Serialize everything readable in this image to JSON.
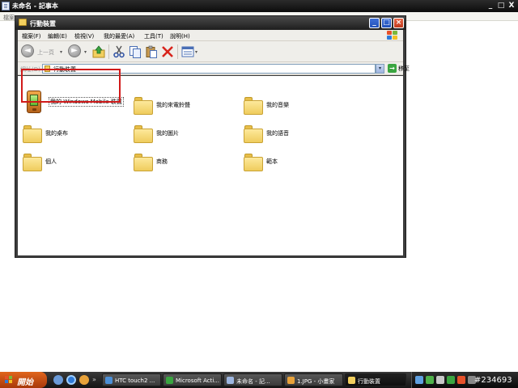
{
  "notepad": {
    "title": "未命名 - 記事本",
    "menu_file": "檔案",
    "minimize": "_",
    "maximize": "□",
    "close": "X"
  },
  "explorer": {
    "title": "行動裝置",
    "menu": [
      "檔案(F)",
      "編輯(E)",
      "檢視(V)",
      "我的最愛(A)",
      "工具(T)",
      "說明(H)"
    ],
    "toolbar": {
      "back_label": "上一頁",
      "back_glyph": "◄",
      "forward_glyph": "►",
      "dropdown_glyph": "▾"
    },
    "address": {
      "label": "網址(D)",
      "value": "行動裝置",
      "dropdown_glyph": "▾",
      "go_glyph": "→",
      "go_label": "移至"
    },
    "items": [
      {
        "label": "我的 Windows Mobile 裝置",
        "icon": "pda-device-icon"
      },
      {
        "label": "我的來電鈴聲",
        "icon": "folder-icon"
      },
      {
        "label": "我的音樂",
        "icon": "folder-icon"
      },
      {
        "label": "我的桌布",
        "icon": "folder-icon"
      },
      {
        "label": "我的圖片",
        "icon": "folder-icon"
      },
      {
        "label": "我的語音",
        "icon": "folder-icon"
      },
      {
        "label": "個人",
        "icon": "folder-icon"
      },
      {
        "label": "商務",
        "icon": "folder-icon"
      },
      {
        "label": "範本",
        "icon": "folder-icon"
      }
    ]
  },
  "taskbar": {
    "start": "開始",
    "tasks": [
      {
        "label": "HTC touch2 ...",
        "icon_color": "#4c8fd6"
      },
      {
        "label": "Microsoft Acti...",
        "icon_color": "#3aa540"
      },
      {
        "label": "未命名 - 記...",
        "icon_color": "#9db6e0"
      },
      {
        "label": "1.JPG - 小畫家",
        "icon_color": "#e8a23a"
      },
      {
        "label": "行動裝置",
        "icon_color": "#f2cf5e"
      }
    ],
    "watermark": "#234693"
  },
  "colors": {
    "highlight": "#d11a1a",
    "folder": "#f2cf5e",
    "titlebar": "#1e1e1e"
  }
}
